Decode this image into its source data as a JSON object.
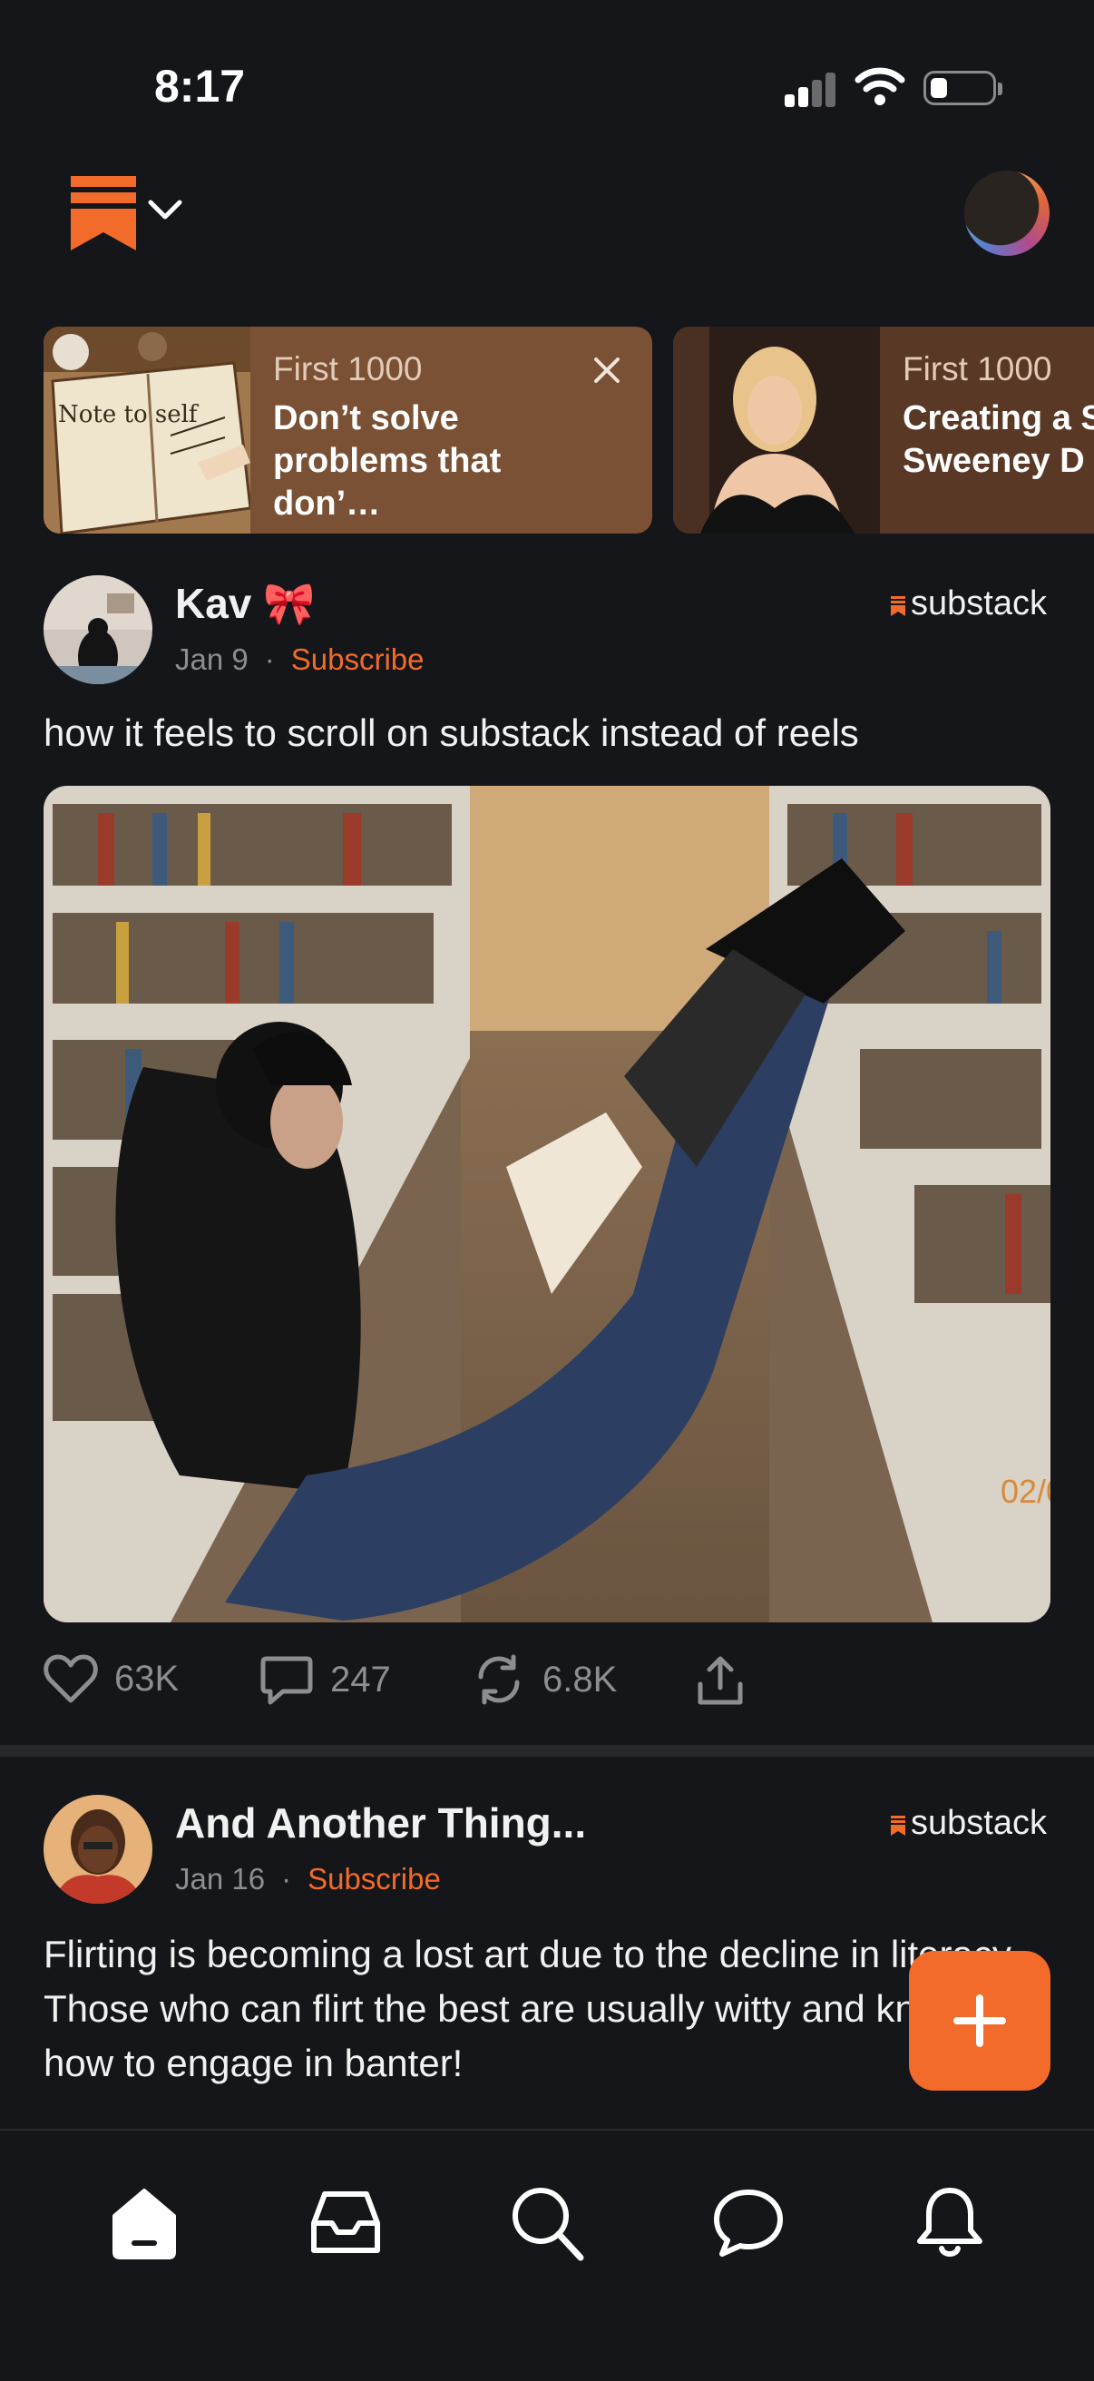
{
  "status_bar": {
    "time": "8:17"
  },
  "header": {
    "logo_icon": "substack-bookmark-logo",
    "menu_icon": "chevron-down-icon"
  },
  "stories": [
    {
      "kicker": "First 1000",
      "title": "Don’t solve problems that don’…",
      "thumb_text": "Note to self"
    },
    {
      "kicker": "First 1000",
      "title": "Creating a S Sweeney D"
    }
  ],
  "posts": [
    {
      "author": "Kav 🎀",
      "date": "Jan 9",
      "subscribe": "Subscribe",
      "brand": "substack",
      "text": "how it feels to scroll on substack instead of reels",
      "photo_stamp": "02/0",
      "likes": "63K",
      "comments": "247",
      "restacks": "6.8K"
    },
    {
      "author": "And Another Thing...",
      "date": "Jan 16",
      "subscribe": "Subscribe",
      "brand": "substack",
      "text": "Flirting is becoming a lost art due to the decline in literacy. Those who can flirt the best are usually witty and know how to engage in banter!"
    }
  ],
  "colors": {
    "accent": "#f26b2a",
    "background": "#151619"
  },
  "tabbar": {
    "items": [
      "home-icon",
      "inbox-icon",
      "search-icon",
      "chat-icon",
      "bell-icon"
    ]
  }
}
